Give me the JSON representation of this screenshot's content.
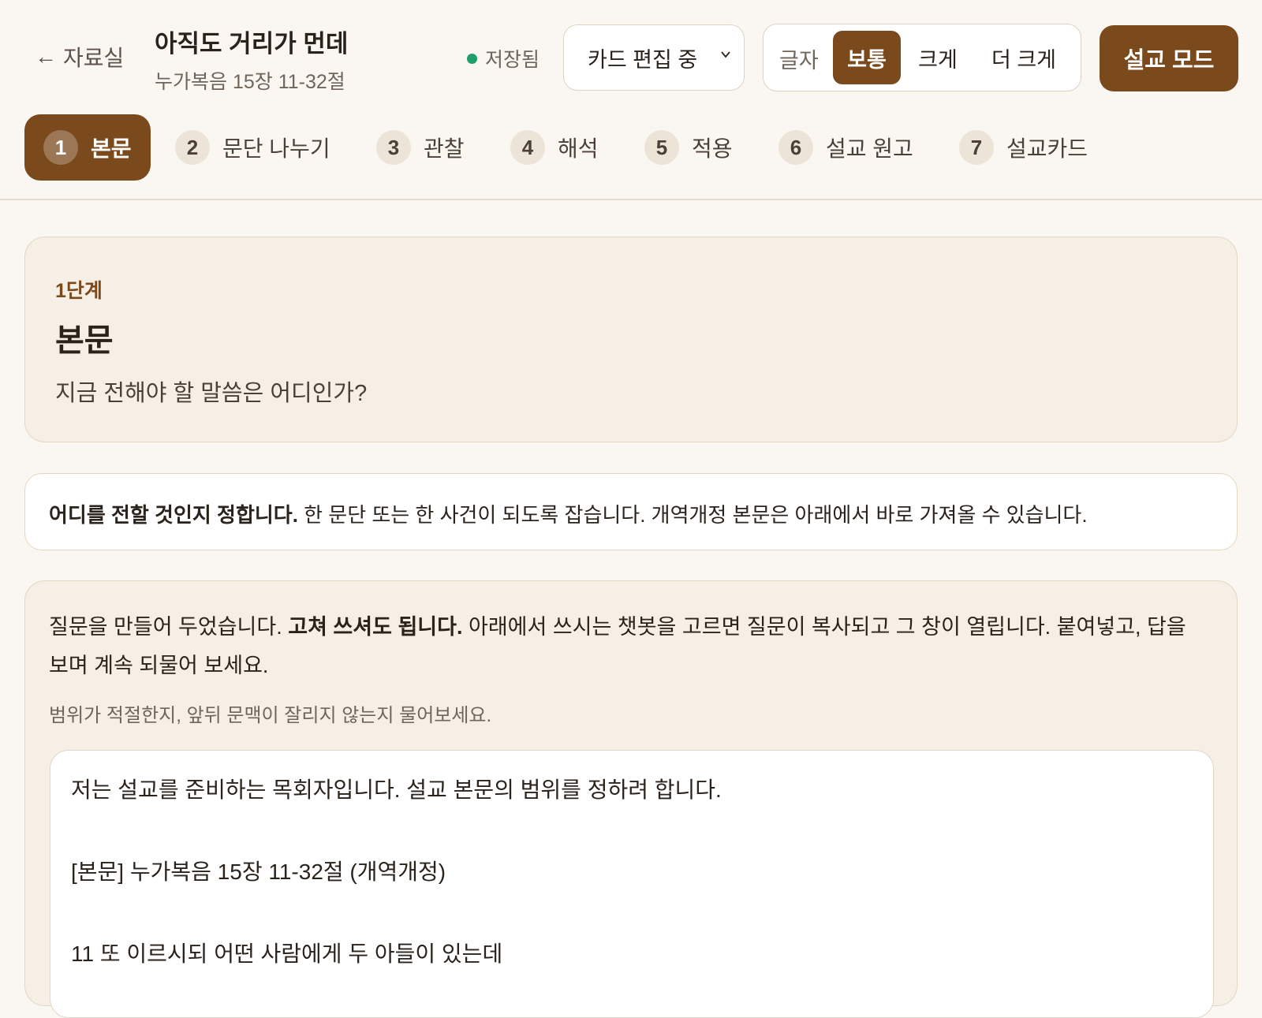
{
  "header": {
    "back_label": "자료실",
    "title": "아직도 거리가 먼데",
    "passage": "누가복음 15장 11-32절",
    "save_status": "저장됨",
    "mode_select_value": "카드 편집 중",
    "font_size": {
      "label": "글자",
      "options": [
        "보통",
        "크게",
        "더 크게"
      ],
      "selected": "보통"
    },
    "sermon_mode_label": "설교 모드"
  },
  "steps": [
    {
      "num": "1",
      "label": "본문",
      "active": true
    },
    {
      "num": "2",
      "label": "문단 나누기"
    },
    {
      "num": "3",
      "label": "관찰"
    },
    {
      "num": "4",
      "label": "해석"
    },
    {
      "num": "5",
      "label": "적용"
    },
    {
      "num": "6",
      "label": "설교 원고"
    },
    {
      "num": "7",
      "label": "설교카드"
    }
  ],
  "stage": {
    "label": "1단계",
    "title": "본문",
    "question": "지금 전해야 할 말씀은 어디인가?"
  },
  "guide": {
    "bold": "어디를 전할 것인지 정합니다.",
    "text": " 한 문단 또는 한 사건이 되도록 잡습니다. 개역개정 본문은 아래에서 바로 가져올 수 있습니다."
  },
  "prompt": {
    "intro_a": "질문을 만들어 두었습니다. ",
    "intro_bold": "고쳐 쓰셔도 됩니다.",
    "intro_b": " 아래에서 쓰시는 챗봇을 고르면 질문이 복사되고 그 창이 열립니다. 붙여넣고, 답을 보며 계속 되물어 보세요.",
    "hint": "범위가 적절한지, 앞뒤 문맥이 잘리지 않는지 물어보세요.",
    "lines": [
      "저는 설교를 준비하는 목회자입니다. 설교 본문의 범위를 정하려 합니다.",
      "",
      "[본문] 누가복음 15장 11-32절 (개역개정)",
      "",
      "11 또 이르시되 어떤 사람에게 두 아들이 있는데"
    ]
  },
  "colors": {
    "accent": "#7a4a1c",
    "background": "#faf7f2",
    "card": "#f6efe5",
    "saved_dot": "#1e9e6a"
  }
}
